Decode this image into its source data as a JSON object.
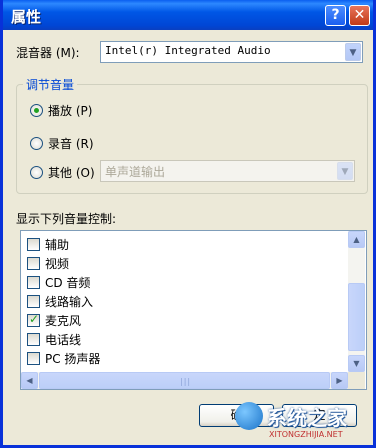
{
  "window": {
    "title": "属性",
    "help_glyph": "?",
    "close_glyph": "✕"
  },
  "mixer": {
    "label": "混音器 (M):",
    "value": "Intel(r) Integrated Audio"
  },
  "volume_group": {
    "title": "调节音量",
    "options": [
      {
        "label": "播放 (P)",
        "selected": true
      },
      {
        "label": "录音 (R)",
        "selected": false
      },
      {
        "label": "其他 (O)",
        "selected": false
      }
    ],
    "other_select_value": "单声道输出"
  },
  "controls": {
    "label": "显示下列音量控制:",
    "items": [
      {
        "label": "辅助",
        "checked": false
      },
      {
        "label": "视频",
        "checked": false
      },
      {
        "label": "CD 音频",
        "checked": false
      },
      {
        "label": "线路输入",
        "checked": false
      },
      {
        "label": "麦克风",
        "checked": true
      },
      {
        "label": "电话线",
        "checked": false
      },
      {
        "label": "PC 扬声器",
        "checked": false
      }
    ]
  },
  "buttons": {
    "ok_partial": "确",
    "cancel_partial": "定"
  },
  "watermark": {
    "brand": "系统之家",
    "url": "XITONGZHIJIA.NET"
  },
  "colors": {
    "title_bar": "#0054e3",
    "window_bg": "#ece9d8",
    "group_title": "#0046d5",
    "check_green": "#21a121"
  }
}
